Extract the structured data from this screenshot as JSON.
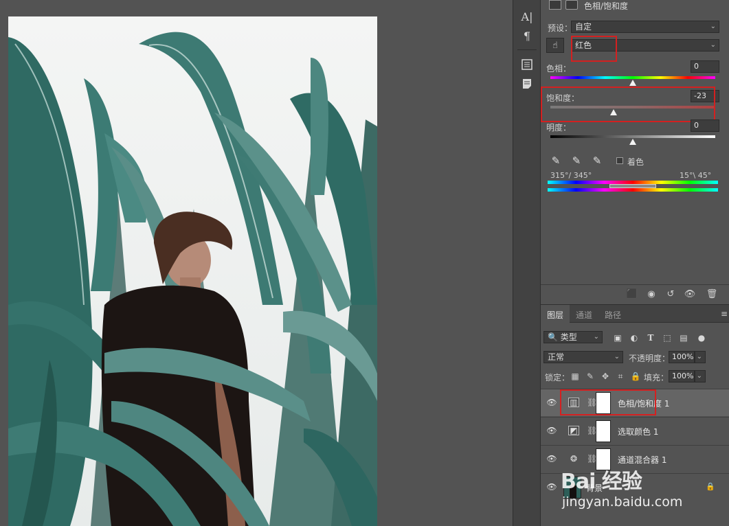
{
  "properties": {
    "title": "色相/饱和度",
    "preset_label": "预设：",
    "preset_value": "自定",
    "channel_value": "红色",
    "hue_label": "色相：",
    "hue_value": "0",
    "saturation_label": "饱和度：",
    "saturation_value": "-23",
    "lightness_label": "明度：",
    "lightness_value": "0",
    "colorize_label": "着色",
    "range_left": "315°/ 345°",
    "range_right": "15°\\ 45°"
  },
  "strip": {
    "icons": [
      "character-icon",
      "paragraph-icon",
      "properties-icon",
      "notes-icon"
    ]
  },
  "layers": {
    "tabs": [
      "图层",
      "通道",
      "路径"
    ],
    "filter_kind": "类型",
    "blend_mode": "正常",
    "opacity_label": "不透明度：",
    "opacity_value": "100%",
    "lock_label": "锁定：",
    "fill_label": "填充：",
    "fill_value": "100%",
    "items": [
      {
        "name": "色相/饱和度 1",
        "icon": "hue-saturation-icon"
      },
      {
        "name": "选取颜色 1",
        "icon": "selective-color-icon"
      },
      {
        "name": "通道混合器 1",
        "icon": "channel-mixer-icon"
      },
      {
        "name": "背景",
        "icon": "background-thumbnail"
      }
    ]
  },
  "watermark": {
    "logo": "Bai 经验",
    "url": "jingyan.baidu.com"
  },
  "colors": {
    "highlight": "#d42020",
    "panel_bg": "#535353",
    "selected_row": "#656565"
  }
}
